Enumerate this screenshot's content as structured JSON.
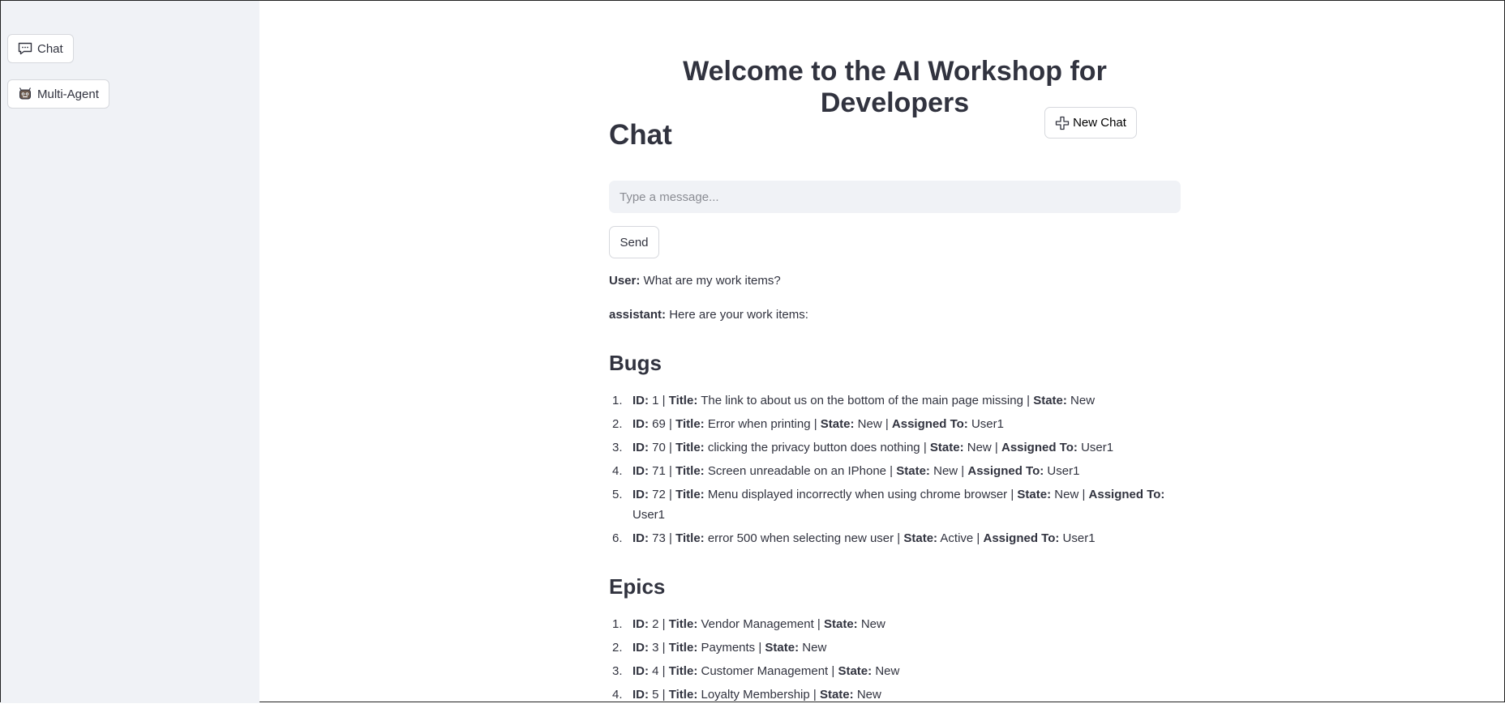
{
  "sidebar": {
    "items": [
      {
        "label": "Chat",
        "icon": "speech-bubble-icon"
      },
      {
        "label": "Multi-Agent",
        "icon": "robot-face-icon"
      }
    ]
  },
  "header": {
    "title": "Welcome to the AI Workshop for Developers"
  },
  "chat": {
    "heading": "Chat",
    "new_chat_label": "New Chat",
    "input_placeholder": "Type a message...",
    "send_label": "Send"
  },
  "messages": {
    "user_role": "User:",
    "user_text": "What are my work items?",
    "assistant_role": "assistant:",
    "assistant_text": "Here are your work items:"
  },
  "labels": {
    "id": "ID:",
    "title": "Title:",
    "state": "State:",
    "assigned": "Assigned To:"
  },
  "bugs": {
    "heading": "Bugs",
    "items": [
      {
        "num": "1.",
        "id": "1",
        "title": "The link to about us on the bottom of the main page missing",
        "state": "New",
        "assigned": ""
      },
      {
        "num": "2.",
        "id": "69",
        "title": "Error when printing",
        "state": "New",
        "assigned": "User1"
      },
      {
        "num": "3.",
        "id": "70",
        "title": "clicking the privacy button does nothing",
        "state": "New",
        "assigned": "User1"
      },
      {
        "num": "4.",
        "id": "71",
        "title": "Screen unreadable on an IPhone",
        "state": "New",
        "assigned": "User1"
      },
      {
        "num": "5.",
        "id": "72",
        "title": "Menu displayed incorrectly when using chrome browser",
        "state": "New",
        "assigned": "User1"
      },
      {
        "num": "6.",
        "id": "73",
        "title": "error 500 when selecting new user",
        "state": "Active",
        "assigned": "User1"
      }
    ]
  },
  "epics": {
    "heading": "Epics",
    "items": [
      {
        "num": "1.",
        "id": "2",
        "title": "Vendor Management",
        "state": "New"
      },
      {
        "num": "2.",
        "id": "3",
        "title": "Payments",
        "state": "New"
      },
      {
        "num": "3.",
        "id": "4",
        "title": "Customer Management",
        "state": "New"
      },
      {
        "num": "4.",
        "id": "5",
        "title": "Loyalty Membership",
        "state": "New"
      }
    ]
  }
}
